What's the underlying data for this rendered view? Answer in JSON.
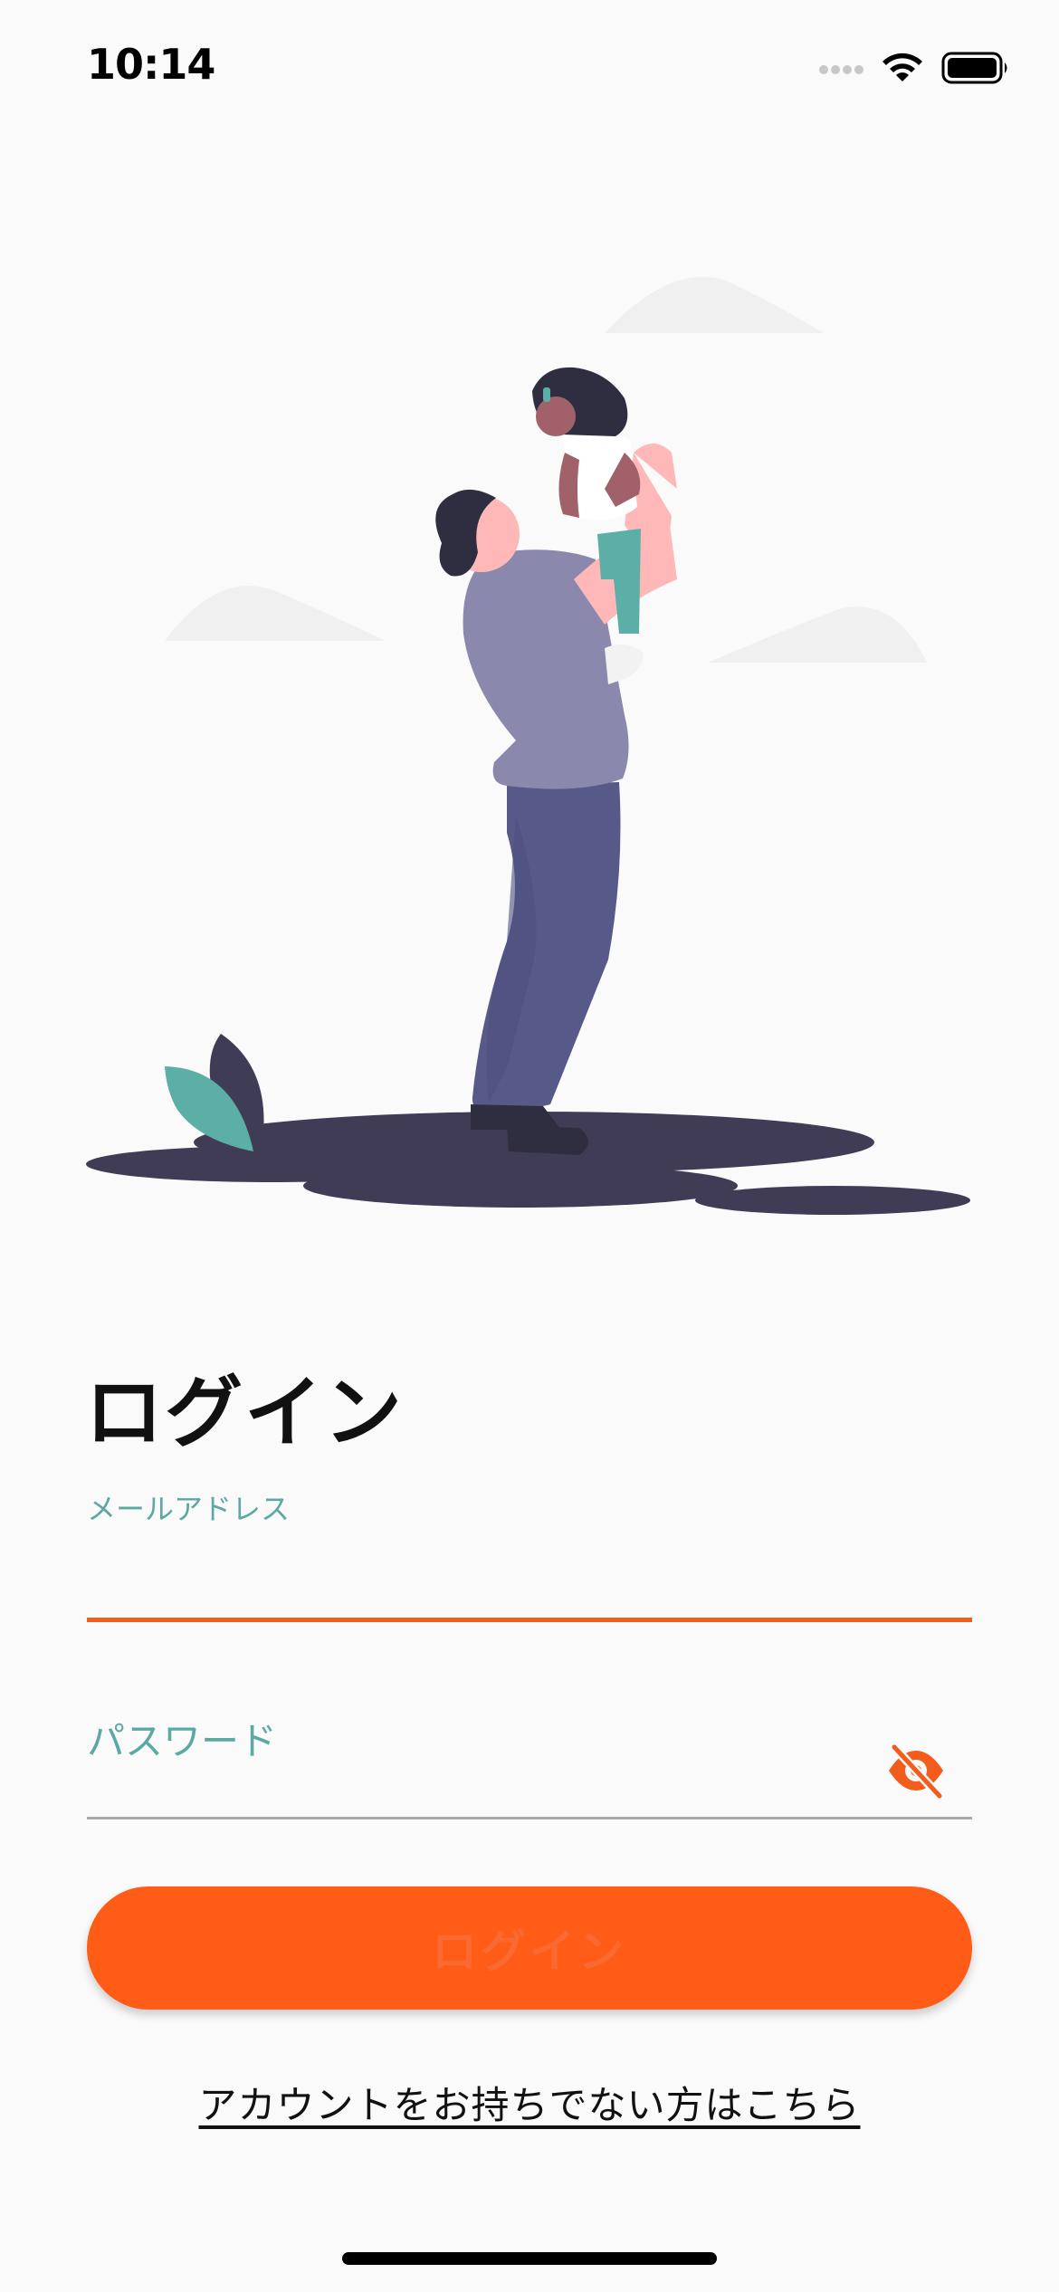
{
  "status_bar": {
    "time": "10:14"
  },
  "icons": {
    "signal": "signal-dots-icon",
    "wifi": "wifi-icon",
    "battery": "battery-icon",
    "visibility_toggle": "eye-off-icon"
  },
  "colors": {
    "accent": "#FF5C17",
    "label": "#5BA9A2",
    "background": "#FAFAFA"
  },
  "login": {
    "title": "ログイン",
    "email_label": "メールアドレス",
    "email_value": "",
    "password_placeholder": "パスワード",
    "password_value": "",
    "button_label": "ログイン",
    "signup_link": "アカウントをお持ちでない方はこちら"
  }
}
